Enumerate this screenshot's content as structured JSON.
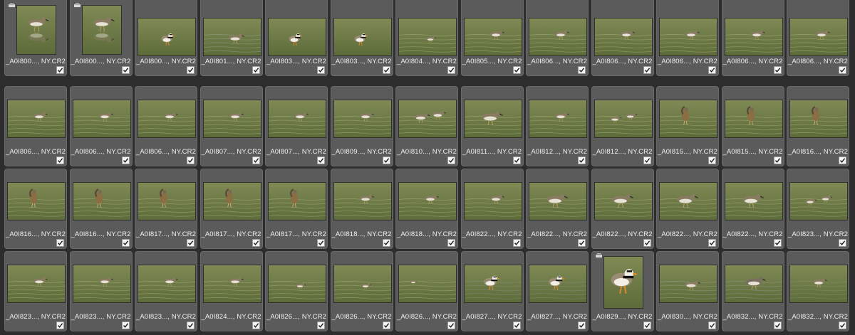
{
  "grid": {
    "rows": [
      [
        {
          "name": "_A0I800..., NY.CR2",
          "scene": "portrait-reflect",
          "stacked": true,
          "checked": true
        },
        {
          "name": "_A0I800..., NY.CR2",
          "scene": "portrait-reflect",
          "stacked": true,
          "checked": true
        },
        {
          "name": "_A0I800..., NY.CR2",
          "scene": "plover-mud",
          "checked": true
        },
        {
          "name": "_A0I801..., NY.CR2",
          "scene": "sandpiper-wet",
          "checked": true
        },
        {
          "name": "_A0I803..., NY.CR2",
          "scene": "dark-mud",
          "checked": true
        },
        {
          "name": "_A0I803..., NY.CR2",
          "scene": "dark-mud",
          "checked": true
        },
        {
          "name": "_A0I804..., NY.CR2",
          "scene": "green-small",
          "checked": true
        },
        {
          "name": "_A0I805..., NY.CR2",
          "scene": "green",
          "checked": true
        },
        {
          "name": "_A0I806..., NY.CR2",
          "scene": "green",
          "checked": true
        },
        {
          "name": "_A0I806..., NY.CR2",
          "scene": "green",
          "checked": true
        },
        {
          "name": "_A0I806..., NY.CR2",
          "scene": "green",
          "checked": true
        },
        {
          "name": "_A0I806..., NY.CR2",
          "scene": "green",
          "checked": true
        },
        {
          "name": "_A0I806..., NY.CR2",
          "scene": "green",
          "checked": true
        }
      ],
      [
        {
          "name": "_A0I806..., NY.CR2",
          "scene": "green",
          "checked": true
        },
        {
          "name": "_A0I806..., NY.CR2",
          "scene": "green",
          "checked": true
        },
        {
          "name": "_A0I806..., NY.CR2",
          "scene": "green",
          "checked": true
        },
        {
          "name": "_A0I807..., NY.CR2",
          "scene": "green",
          "checked": true
        },
        {
          "name": "_A0I807..., NY.CR2",
          "scene": "green",
          "checked": true
        },
        {
          "name": "_A0I809..., NY.CR2",
          "scene": "green",
          "checked": true
        },
        {
          "name": "_A0I810..., NY.CR2",
          "scene": "green-two",
          "checked": true
        },
        {
          "name": "_A0I811..., NY.CR2",
          "scene": "green-large",
          "checked": true
        },
        {
          "name": "_A0I812..., NY.CR2",
          "scene": "green",
          "checked": true
        },
        {
          "name": "_A0I812..., NY.CR2",
          "scene": "green-two-small",
          "checked": true
        },
        {
          "name": "_A0I815..., NY.CR2",
          "scene": "green-preen",
          "checked": true
        },
        {
          "name": "_A0I815..., NY.CR2",
          "scene": "green-preen",
          "checked": true
        },
        {
          "name": "_A0I816..., NY.CR2",
          "scene": "green-preen",
          "checked": true
        }
      ],
      [
        {
          "name": "_A0I816..., NY.CR2",
          "scene": "green-preen",
          "checked": true
        },
        {
          "name": "_A0I816..., NY.CR2",
          "scene": "green-preen",
          "checked": true
        },
        {
          "name": "_A0I817..., NY.CR2",
          "scene": "green-preen",
          "checked": true
        },
        {
          "name": "_A0I817..., NY.CR2",
          "scene": "green-preen",
          "checked": true
        },
        {
          "name": "_A0I817..., NY.CR2",
          "scene": "green-preen",
          "checked": true
        },
        {
          "name": "_A0I818..., NY.CR2",
          "scene": "green",
          "checked": true
        },
        {
          "name": "_A0I818..., NY.CR2",
          "scene": "green",
          "checked": true
        },
        {
          "name": "_A0I822..., NY.CR2",
          "scene": "green",
          "checked": true
        },
        {
          "name": "_A0I822..., NY.CR2",
          "scene": "green-large",
          "checked": true
        },
        {
          "name": "_A0I822..., NY.CR2",
          "scene": "green-large",
          "checked": true
        },
        {
          "name": "_A0I822..., NY.CR2",
          "scene": "green-large",
          "checked": true
        },
        {
          "name": "_A0I822..., NY.CR2",
          "scene": "green-large",
          "checked": true
        },
        {
          "name": "_A0I823..., NY.CR2",
          "scene": "green-two-small",
          "checked": true
        }
      ],
      [
        {
          "name": "_A0I823..., NY.CR2",
          "scene": "green",
          "checked": true
        },
        {
          "name": "_A0I823..., NY.CR2",
          "scene": "green",
          "checked": true
        },
        {
          "name": "_A0I823..., NY.CR2",
          "scene": "green",
          "checked": true
        },
        {
          "name": "_A0I824..., NY.CR2",
          "scene": "green",
          "checked": true
        },
        {
          "name": "_A0I826..., NY.CR2",
          "scene": "green-small",
          "checked": true
        },
        {
          "name": "_A0I826..., NY.CR2",
          "scene": "green-small",
          "checked": true
        },
        {
          "name": "_A0I826..., NY.CR2",
          "scene": "green-tiny",
          "checked": true
        },
        {
          "name": "_A0I827..., NY.CR2",
          "scene": "plover-grey",
          "checked": true
        },
        {
          "name": "_A0I827..., NY.CR2",
          "scene": "plover-grey",
          "checked": true
        },
        {
          "name": "_A0I829..., NY.CR2",
          "scene": "plover-portrait",
          "stacked": true,
          "checked": true
        },
        {
          "name": "_A0I830..., NY.CR2",
          "scene": "sandpiper-wet",
          "checked": true
        },
        {
          "name": "_A0I832..., NY.CR2",
          "scene": "sandpiper-grey",
          "checked": true
        },
        {
          "name": "_A0I832..., NY.CR2",
          "scene": "green-dark",
          "checked": true
        }
      ]
    ]
  },
  "colors": {
    "cell_bg": "#5b5b5b",
    "page_bg": "#2d2d2d",
    "label_text": "#f0f0f0"
  },
  "icons": {
    "checkbox": "checkbox-checked-icon",
    "stack": "stack-icon"
  }
}
